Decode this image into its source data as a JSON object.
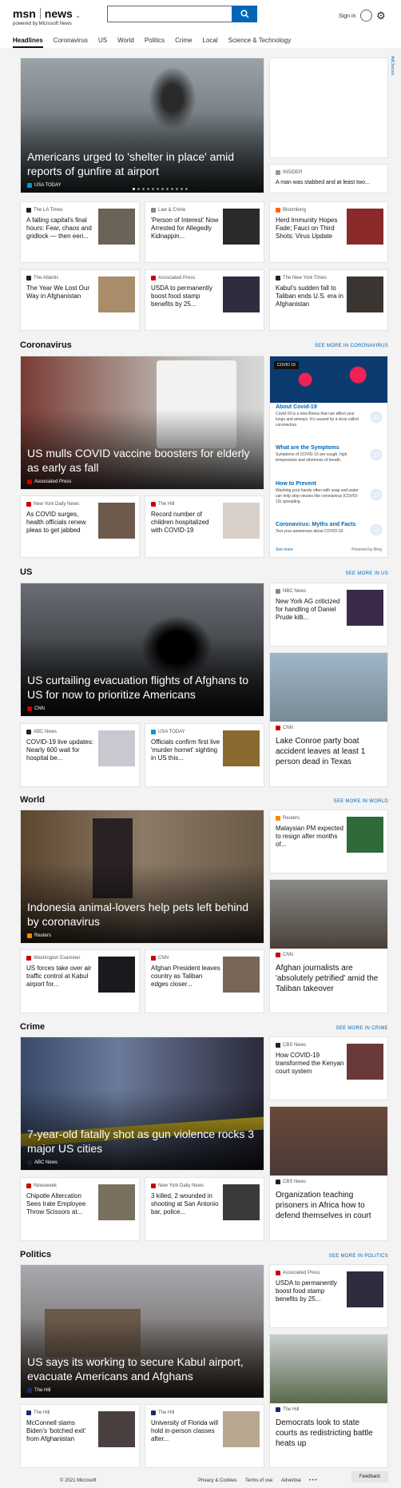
{
  "header": {
    "logo": "msn",
    "brand": "news",
    "powered": "powered by Microsoft News",
    "signin": "Sign in",
    "search_placeholder": ""
  },
  "nav": [
    "Headlines",
    "Coronavirus",
    "US",
    "World",
    "Politics",
    "Crime",
    "Local",
    "Science & Technology"
  ],
  "adchoices": "AdChoices",
  "hero1": {
    "title": "Americans urged to 'shelter in place' amid reports of gunfire at airport",
    "source": "USA TODAY"
  },
  "side1": {
    "source": "INSIDER",
    "title": "A man was stabbed and at least two..."
  },
  "row1": [
    {
      "source": "The LA Times",
      "title": "A falling capital's final hours: Fear, chaos and gridlock — then eeri..."
    },
    {
      "source": "Law & Crime",
      "title": "'Person of Interest' Now Arrested for Allegedly Kidnappin..."
    },
    {
      "source": "Bloomberg",
      "title": "Herd Immunity Hopes Fade; Fauci on Third Shots: Virus Update"
    }
  ],
  "row2": [
    {
      "source": "The Atlantic",
      "title": "The Year We Lost Our Way in Afghanistan"
    },
    {
      "source": "Associated Press",
      "title": "USDA to permanently boost food stamp benefits by 25..."
    },
    {
      "source": "The New York Times",
      "title": "Kabul's sudden fall to Taliban ends U.S. era in Afghanistan"
    }
  ],
  "sections": {
    "coronavirus": {
      "title": "Coronavirus",
      "more": "SEE MORE IN CORONAVIRUS",
      "hero": {
        "title": "US mulls COVID vaccine boosters for elderly as early as fall",
        "source": "Associated Press"
      },
      "cards": [
        {
          "source": "New York Daily News",
          "title": "As COVID surges, health officials renew pleas to get jabbed"
        },
        {
          "source": "The Hill",
          "title": "Record number of children hospitalized with COVID-19"
        }
      ],
      "box": {
        "tag": "COVID 19",
        "items": [
          {
            "h": "About Covid-19",
            "p": "Covid-19 is a new illness that can affect your lungs and airways. It's caused by a virus called coronavirus."
          },
          {
            "h": "What are the Symptoms",
            "p": "Symptoms of COVID-19 are cough, high temperature and shortness of breath."
          },
          {
            "h": "How to Prevent",
            "p": "Washing your hands often with soap and water can help stop viruses like coronavirus (COVID-19) spreading."
          },
          {
            "h": "Coronavirus: Myths and Facts",
            "p": "Test your awareness about COVID-19."
          }
        ],
        "seemore": "See more",
        "powered": "Powered by Bing"
      }
    },
    "us": {
      "title": "US",
      "more": "SEE MORE IN US",
      "hero": {
        "title": "US curtailing evacuation flights of Afghans to US for now to prioritize Americans",
        "source": "CNN"
      },
      "side": {
        "source": "NBC News",
        "title": "New York AG criticized for handling of Daniel Prude killi..."
      },
      "cards": [
        {
          "source": "ABC News",
          "title": "COVID-19 live updates: Nearly 600 wait for hospital be..."
        },
        {
          "source": "USA TODAY",
          "title": "Officials confirm first live 'murder hornet' sighting in US this..."
        }
      ],
      "tall": {
        "source": "CNN",
        "title": "Lake Conroe party boat accident leaves at least 1 person dead in Texas"
      }
    },
    "world": {
      "title": "World",
      "more": "SEE MORE IN WORLD",
      "hero": {
        "title": "Indonesia animal-lovers help pets left behind by coronavirus",
        "source": "Reuters"
      },
      "side": {
        "source": "Reuters",
        "title": "Malaysian PM expected to resign after months of..."
      },
      "cards": [
        {
          "source": "Washington Examiner",
          "title": "US forces take over air traffic control at Kabul airport for..."
        },
        {
          "source": "CNN",
          "title": "Afghan President leaves country as Taliban edges closer..."
        }
      ],
      "tall": {
        "source": "CNN",
        "title": "Afghan journalists are 'absolutely petrified' amid the Taliban takeover"
      }
    },
    "crime": {
      "title": "Crime",
      "more": "SEE MORE IN CRIME",
      "hero": {
        "title": "7-year-old fatally shot as gun violence rocks 3 major US cities",
        "source": "ABC News"
      },
      "side": {
        "source": "CBS News",
        "title": "How COVID-19 transformed the Kenyan court system"
      },
      "cards": [
        {
          "source": "Newsweek",
          "title": "Chipotle Altercation Sees Irate Employee Throw Scissors at..."
        },
        {
          "source": "New York Daily News",
          "title": "3 killed, 2 wounded in shooting at San Antonio bar, police..."
        }
      ],
      "tall": {
        "source": "CBS News",
        "title": "Organization teaching prisoners in Africa how to defend themselves in court"
      }
    },
    "politics": {
      "title": "Politics",
      "more": "SEE MORE IN POLITICS",
      "hero": {
        "title": "US says its working to secure Kabul airport, evacuate Americans and Afghans",
        "source": "The Hill"
      },
      "side": {
        "source": "Associated Press",
        "title": "USDA to permanently boost food stamp benefits by 25..."
      },
      "cards": [
        {
          "source": "The Hill",
          "title": "McConnell slams Biden's 'botched exit' from Afghanistan"
        },
        {
          "source": "The Hill",
          "title": "University of Florida will hold in-person classes after..."
        }
      ],
      "tall": {
        "source": "The Hill",
        "title": "Democrats look to state courts as redistricting battle heats up"
      }
    }
  },
  "footer": {
    "copyright": "© 2021 Microsoft",
    "privacy": "Privacy & Cookies",
    "terms": "Terms of use",
    "advertise": "Advertise",
    "more": "• • •",
    "feedback": "Feedback"
  }
}
